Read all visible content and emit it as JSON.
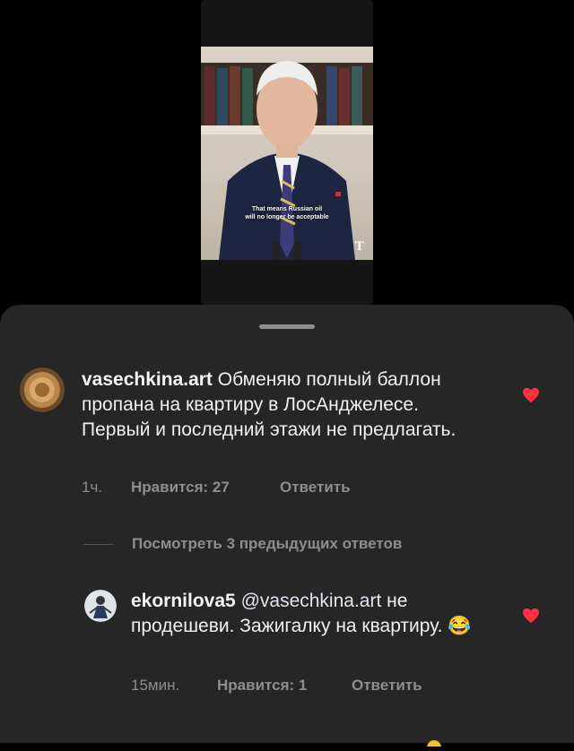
{
  "video": {
    "caption_line1": "That means Russian oil",
    "caption_line2": "will no longer be acceptable",
    "logo": "T"
  },
  "comments": [
    {
      "username": "vasechkina.art",
      "text": " Обменяю полный баллон пропана на квартиру в ЛосАнджелесе. Первый и последний этажи не предлагать.",
      "time": "1ч.",
      "likes": "Нравится: 27",
      "reply": "Ответить",
      "liked": true
    }
  ],
  "view_replies": "Посмотреть 3 предыдущих ответов",
  "replies": [
    {
      "username": "ekornilova5",
      "mention": "@vasechkina.art",
      "text": " не продешеви. Зажигалку на квартиру. 😂",
      "time": "15мин.",
      "likes": "Нравится: 1",
      "reply": "Ответить",
      "liked": true
    }
  ],
  "colors": {
    "heart": "#ff3040",
    "sheet": "#262626",
    "meta": "#8e8e8e"
  }
}
